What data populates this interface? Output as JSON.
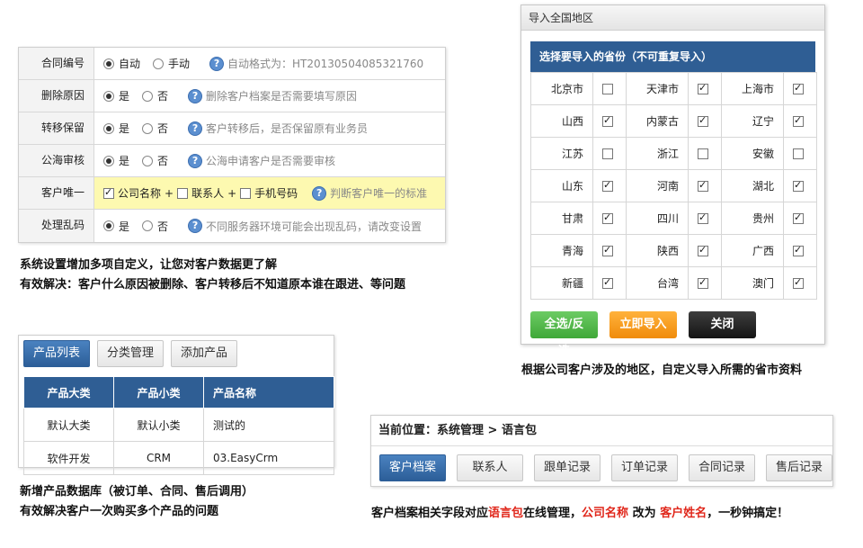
{
  "settings": {
    "rows": [
      {
        "label": "合同编号",
        "opt1": "自动",
        "opt2": "手动",
        "hint": "自动格式为：HT20130504085321760"
      },
      {
        "label": "删除原因",
        "opt1": "是",
        "opt2": "否",
        "hint": "删除客户档案是否需要填写原因"
      },
      {
        "label": "转移保留",
        "opt1": "是",
        "opt2": "否",
        "hint": "客户转移后，是否保留原有业务员"
      },
      {
        "label": "公海审核",
        "opt1": "是",
        "opt2": "否",
        "hint": "公海申请客户是否需要审核"
      },
      {
        "label": "客户唯一",
        "c1": "公司名称",
        "c2": "联系人",
        "c3": "手机号码",
        "plus": "+",
        "hint": "判断客户唯一的标准"
      },
      {
        "label": "处理乱码",
        "opt1": "是",
        "opt2": "否",
        "hint": "不同服务器环境可能会出现乱码，请改变设置"
      }
    ],
    "help_glyph": "?"
  },
  "caption1": {
    "line1": "系统设置增加多项自定义，让您对客户数据更了解",
    "line2": "有效解决：客户什么原因被删除、客户转移后不知道原本谁在跟进、等问题"
  },
  "dialog": {
    "title": "导入全国地区",
    "header": "选择要导入的省份（不可重复导入）",
    "provinces": [
      [
        "北京市",
        false,
        "天津市",
        true,
        "上海市",
        true
      ],
      [
        "山西",
        true,
        "内蒙古",
        true,
        "辽宁",
        true
      ],
      [
        "江苏",
        false,
        "浙江",
        false,
        "安徽",
        false
      ],
      [
        "山东",
        true,
        "河南",
        true,
        "湖北",
        true
      ],
      [
        "甘肃",
        true,
        "四川",
        true,
        "贵州",
        true
      ],
      [
        "青海",
        true,
        "陕西",
        true,
        "广西",
        true
      ],
      [
        "新疆",
        true,
        "台湾",
        true,
        "澳门",
        true
      ]
    ],
    "btn_select": "全选/反选",
    "btn_import": "立即导入",
    "btn_close": "关闭"
  },
  "caption2": "根据公司客户涉及的地区，自定义导入所需的省市资料",
  "product": {
    "tabs": [
      "产品列表",
      "分类管理",
      "添加产品"
    ],
    "headers": [
      "产品大类",
      "产品小类",
      "产品名称"
    ],
    "rows": [
      [
        "默认大类",
        "默认小类",
        "测试的"
      ],
      [
        "软件开发",
        "CRM",
        "03.EasyCrm"
      ]
    ]
  },
  "caption3": {
    "line1": "新增产品数据库（被订单、合同、售后调用）",
    "line2": "有效解决客户一次购买多个产品的问题"
  },
  "lang": {
    "breadcrumb": "当前位置：系统管理 > 语言包",
    "tabs": [
      "客户档案",
      "联系人",
      "跟单记录",
      "订单记录",
      "合同记录",
      "售后记录"
    ]
  },
  "caption4": {
    "p1": "客户档案相关字段对应",
    "p2": "语言包",
    "p3": "在线管理，",
    "p4": "公司名称",
    "p5": " 改为 ",
    "p6": "客户姓名",
    "p7": "，一秒钟搞定！"
  },
  "colors": {
    "blue_header": "#2f5e94",
    "highlight": "#fdf9b0",
    "red": "#e0271b",
    "green": "#3fa838",
    "orange": "#f08b0a"
  }
}
